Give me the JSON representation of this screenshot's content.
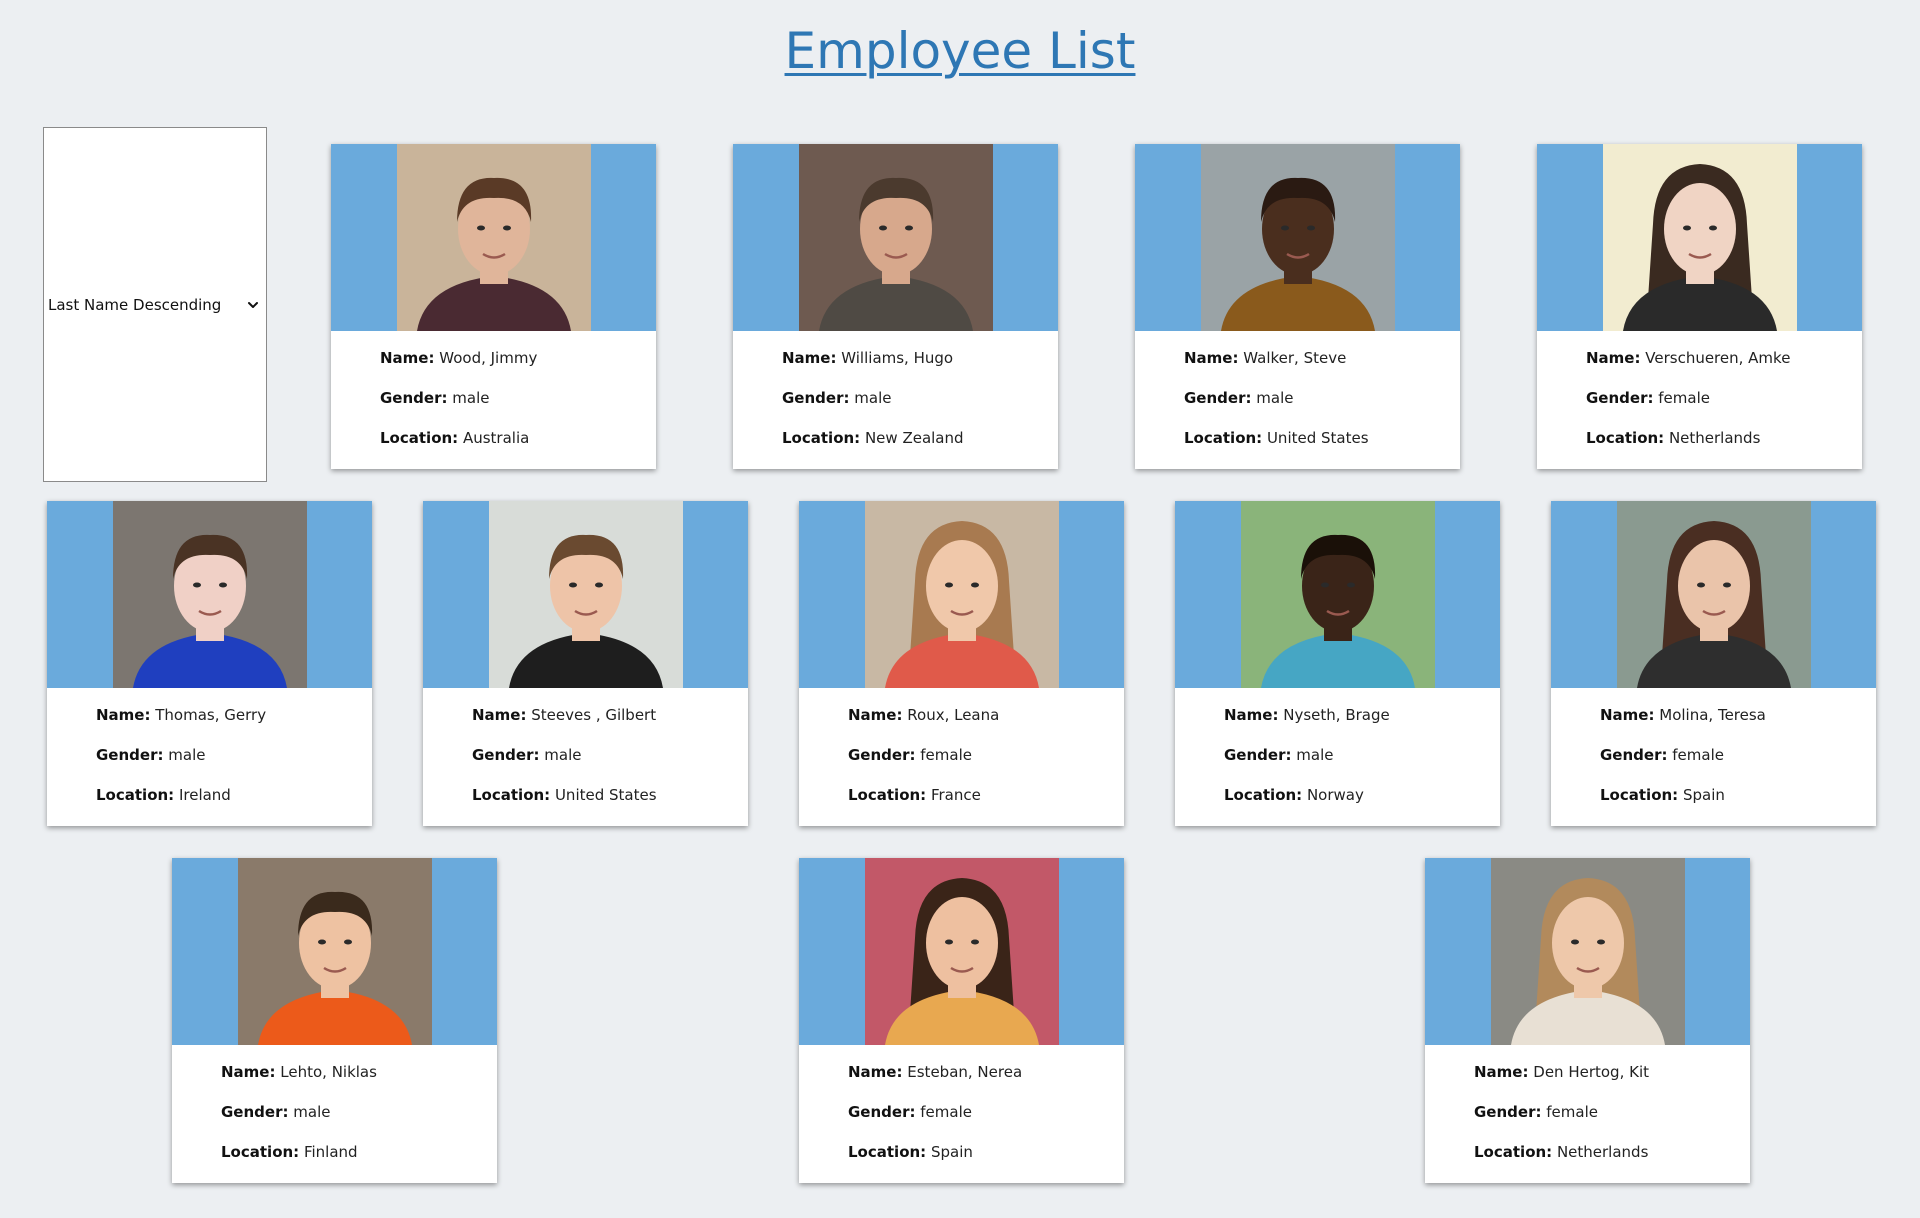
{
  "page": {
    "title": "Employee List"
  },
  "sort": {
    "selected": "Last Name Descending"
  },
  "labels": {
    "name": "Name:",
    "gender": "Gender:",
    "location": "Location:"
  },
  "employees": [
    {
      "name": "Wood, Jimmy",
      "gender": "male",
      "location": "Australia"
    },
    {
      "name": "Williams, Hugo",
      "gender": "male",
      "location": "New Zealand"
    },
    {
      "name": "Walker, Steve",
      "gender": "male",
      "location": "United States"
    },
    {
      "name": "Verschueren, Amke",
      "gender": "female",
      "location": "Netherlands"
    },
    {
      "name": "Thomas, Gerry",
      "gender": "male",
      "location": "Ireland"
    },
    {
      "name": "Steeves , Gilbert",
      "gender": "male",
      "location": "United States"
    },
    {
      "name": "Roux, Leana",
      "gender": "female",
      "location": "France"
    },
    {
      "name": "Nyseth, Brage",
      "gender": "male",
      "location": "Norway"
    },
    {
      "name": "Molina, Teresa",
      "gender": "female",
      "location": "Spain"
    },
    {
      "name": "Lehto, Niklas",
      "gender": "male",
      "location": "Finland"
    },
    {
      "name": "Esteban, Nerea",
      "gender": "female",
      "location": "Spain"
    },
    {
      "name": "Den Hertog, Kit",
      "gender": "female",
      "location": "Netherlands"
    }
  ],
  "colors": {
    "title": "#2e77b4",
    "photo_band": "#6aaadc",
    "background": "#eceff2"
  },
  "portraits": [
    {
      "bg": "#c9b49a",
      "skin": "#e0b59a",
      "hair": "#5a3a26",
      "shirt": "#4a2a32"
    },
    {
      "bg": "#6e5a50",
      "skin": "#d7a88c",
      "hair": "#4b3a2e",
      "shirt": "#4f4a44"
    },
    {
      "bg": "#9aa3a6",
      "skin": "#4a2e1e",
      "hair": "#2a1a12",
      "shirt": "#8a5a1c"
    },
    {
      "bg": "#f2ecd0",
      "skin": "#f0d4c4",
      "hair": "#3a2a20",
      "shirt": "#2a2a2a"
    },
    {
      "bg": "#7c7670",
      "skin": "#f0d0c6",
      "hair": "#4a3324",
      "shirt": "#1f3fbf"
    },
    {
      "bg": "#d8dcd8",
      "skin": "#eec4a8",
      "hair": "#6a4a30",
      "shirt": "#1e1e1e"
    },
    {
      "bg": "#c8b8a4",
      "skin": "#f0c8aa",
      "hair": "#a87a50",
      "shirt": "#e05a4a"
    },
    {
      "bg": "#8ab47a",
      "skin": "#3a2418",
      "hair": "#1a1008",
      "shirt": "#46a6c4"
    },
    {
      "bg": "#8a9a90",
      "skin": "#eac4aa",
      "hair": "#4a2e22",
      "shirt": "#2e2e2e"
    },
    {
      "bg": "#8a7a6a",
      "skin": "#eec2a2",
      "hair": "#3a2a1c",
      "shirt": "#ec5a1a"
    },
    {
      "bg": "#c25868",
      "skin": "#eec0a0",
      "hair": "#3a2418",
      "shirt": "#e8a850"
    },
    {
      "bg": "#8a8a84",
      "skin": "#eec8aa",
      "hair": "#b28a5c",
      "shirt": "#e8e0d4"
    }
  ]
}
